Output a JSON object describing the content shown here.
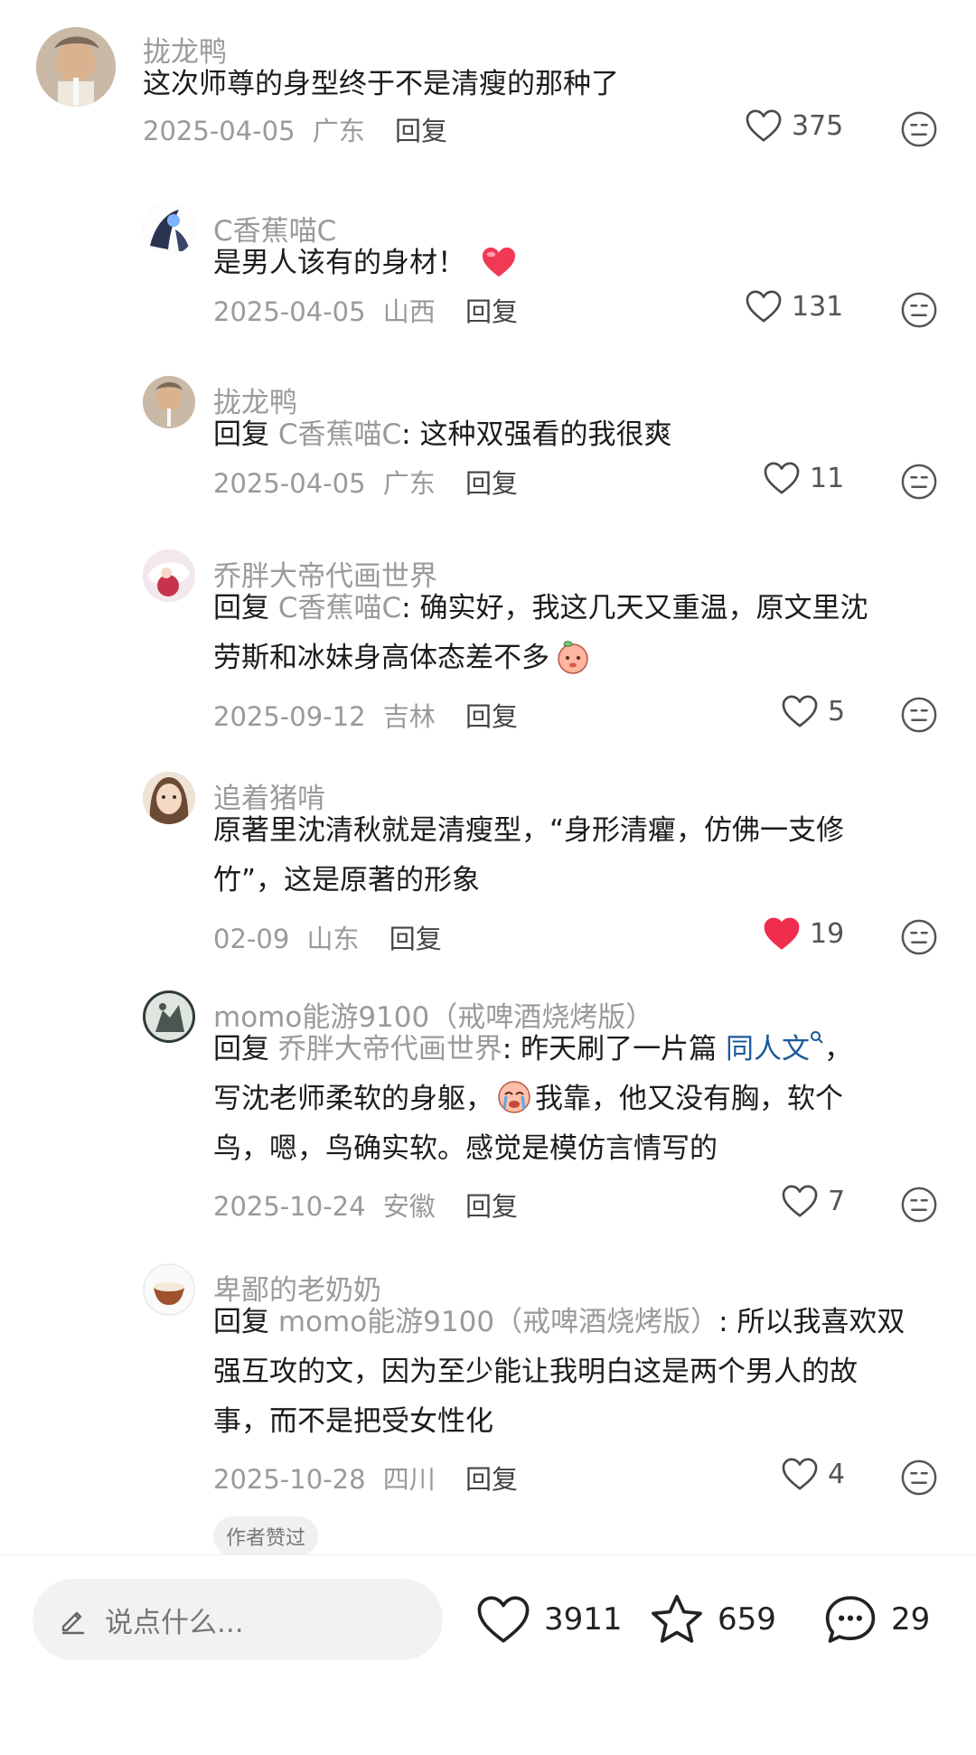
{
  "comments": [
    {
      "name": "拢龙鸭",
      "text": "这次师尊的身型终于不是清瘦的那种了",
      "date": "2025-04-05",
      "region": "广东",
      "reply_label": "回复",
      "likes": "375"
    },
    {
      "name": "C香蕉喵C",
      "text": "是男人该有的身材！",
      "date": "2025-04-05",
      "region": "山西",
      "reply_label": "回复",
      "likes": "131"
    },
    {
      "name": "拢龙鸭",
      "reply_prefix": "回复 ",
      "reply_target": "C香蕉喵C",
      "text": ": 这种双强看的我很爽",
      "date": "2025-04-05",
      "region": "广东",
      "reply_label": "回复",
      "likes": "11"
    },
    {
      "name": "乔胖大帝代画世界",
      "reply_prefix": "回复 ",
      "reply_target": "C香蕉喵C",
      "text_line1": ": 确实好，我这几天又重温，原文里沈",
      "text_line2": "劳斯和冰妹身高体态差不多",
      "date": "2025-09-12",
      "region": "吉林",
      "reply_label": "回复",
      "likes": "5"
    },
    {
      "name": "追着猪啃",
      "text_line1": "原著里沈清秋就是清瘦型，“身形清癯，仿佛一支修",
      "text_line2": "竹”，这是原著的形象",
      "date": "02-09",
      "region": "山东",
      "reply_label": "回复",
      "likes": "19",
      "liked": true
    },
    {
      "name": "momo能游9100（戒啤酒烧烤版）",
      "reply_prefix": "回复 ",
      "reply_target": "乔胖大帝代画世界",
      "text_line1_a": ": 昨天刷了一片篇 ",
      "text_line1_link": "同人文",
      "text_line1_b": "，",
      "text_line2_a": "写沈老师柔软的身躯，",
      "text_line2_b": "我靠，他又没有胸，软个",
      "text_line3": "鸟，嗯，鸟确实软。感觉是模仿言情写的",
      "date": "2025-10-24",
      "region": "安徽",
      "reply_label": "回复",
      "likes": "7"
    },
    {
      "name": "卑鄙的老奶奶",
      "reply_prefix": "回复 ",
      "reply_target": "momo能游9100（戒啤酒烧烤版）",
      "text_line1": ": 所以我喜欢双",
      "text_line2": "强互攻的文，因为至少能让我明白这是两个男人的故",
      "text_line3": "事，而不是把受女性化",
      "date": "2025-10-28",
      "region": "四川",
      "reply_label": "回复",
      "likes": "4",
      "badge": "作者赞过"
    }
  ],
  "bottom_bar": {
    "input_placeholder": "说点什么...",
    "likes": "3911",
    "favorites": "659",
    "comments": "29"
  },
  "colors": {
    "liked_heart": "#f02d4d",
    "link": "#1a5a9a"
  },
  "icons": [
    "heart-icon",
    "meh-face-icon",
    "pen-icon",
    "star-icon",
    "chat-bubble-icon"
  ]
}
